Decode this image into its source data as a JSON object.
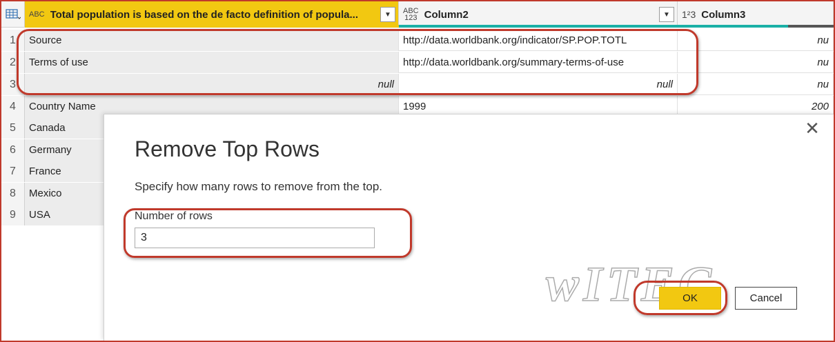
{
  "header": {
    "corner_icon": "table-menu-icon",
    "columns": [
      {
        "type": "ABC",
        "label": "Total population is based on the de facto definition of popula..."
      },
      {
        "type": "ABC\n123",
        "label": "Column2"
      },
      {
        "type": "1²3",
        "label": "Column3"
      }
    ]
  },
  "rows": [
    {
      "num": "1",
      "c1": "Source",
      "c2": "http://data.worldbank.org/indicator/SP.POP.TOTL",
      "c3": "nu"
    },
    {
      "num": "2",
      "c1": "Terms of use",
      "c2": "http://data.worldbank.org/summary-terms-of-use",
      "c3": "nu"
    },
    {
      "num": "3",
      "c1": "null",
      "c2": "null",
      "c3": "nu"
    },
    {
      "num": "4",
      "c1": "Country Name",
      "c2": "1999",
      "c3": "200"
    },
    {
      "num": "5",
      "c1": "Canada",
      "c2": "",
      "c3": ""
    },
    {
      "num": "6",
      "c1": "Germany",
      "c2": "",
      "c3": ""
    },
    {
      "num": "7",
      "c1": "France",
      "c2": "",
      "c3": ""
    },
    {
      "num": "8",
      "c1": "Mexico",
      "c2": "",
      "c3": ""
    },
    {
      "num": "9",
      "c1": "USA",
      "c2": "",
      "c3": ""
    }
  ],
  "dialog": {
    "title": "Remove Top Rows",
    "description": "Specify how many rows to remove from the top.",
    "field_label": "Number of rows",
    "field_value": "3",
    "ok_label": "OK",
    "cancel_label": "Cancel",
    "close_icon": "close-icon"
  },
  "colors": {
    "accent": "#f2c811",
    "highlight": "#c0392b",
    "quality_green": "#1ab0a6"
  }
}
